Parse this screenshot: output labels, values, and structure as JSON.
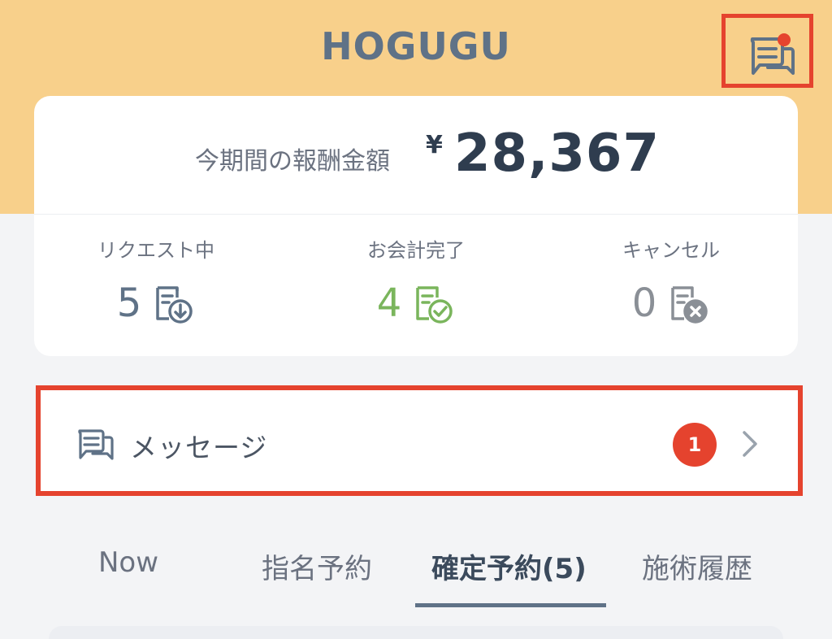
{
  "header": {
    "title": "HOGUGU",
    "background": "#f8d08b",
    "message_icon": "chat-bubbles-icon",
    "has_unread_dot": true
  },
  "summary": {
    "reward_label": "今期間の報酬金額",
    "currency": "¥",
    "reward_amount": "28,367",
    "stats": [
      {
        "label": "リクエスト中",
        "value": "5",
        "color": "#5f7287",
        "icon": "document-download-icon"
      },
      {
        "label": "お会計完了",
        "value": "4",
        "color": "#7ab55c",
        "icon": "document-check-icon"
      },
      {
        "label": "キャンセル",
        "value": "0",
        "color": "#8a8f96",
        "icon": "document-cancel-icon"
      }
    ]
  },
  "message_row": {
    "label": "メッセージ",
    "badge_count": "1",
    "icon": "chat-bubbles-icon"
  },
  "tabs": [
    {
      "label": "Now",
      "active": false
    },
    {
      "label": "指名予約",
      "active": false
    },
    {
      "label": "確定予約(5)",
      "active": true
    },
    {
      "label": "施術履歴",
      "active": false
    }
  ],
  "colors": {
    "accent": "#5f7287",
    "highlight_border": "#e5432e",
    "badge": "#e5432e",
    "success": "#7ab55c"
  }
}
